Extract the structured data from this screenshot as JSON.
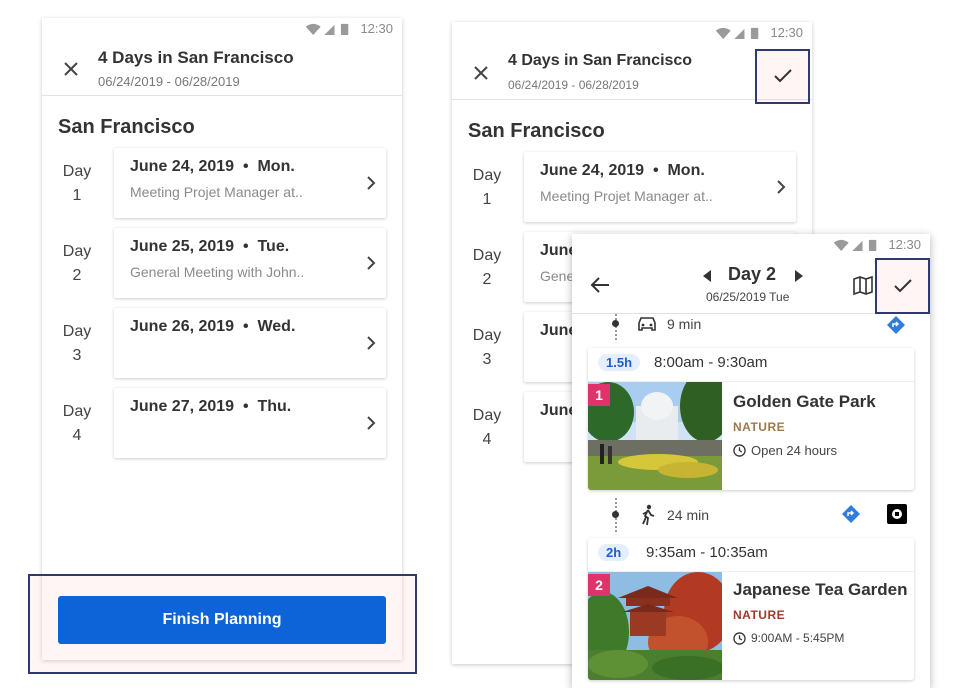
{
  "status": {
    "time": "12:30"
  },
  "trip": {
    "title": "4 Days in San Francisco",
    "dates": "06/24/2019 - 06/28/2019",
    "city": "San Francisco"
  },
  "days": [
    {
      "label_word": "Day",
      "label_num": "1",
      "date": "June 24, 2019",
      "weekday": "Mon.",
      "note": "Meeting Projet Manager at.."
    },
    {
      "label_word": "Day",
      "label_num": "2",
      "date": "June 25, 2019",
      "weekday": "Tue.",
      "note": "General Meeting with John.."
    },
    {
      "label_word": "Day",
      "label_num": "3",
      "date": "June 26, 2019",
      "weekday": "Wed.",
      "note": ""
    },
    {
      "label_word": "Day",
      "label_num": "4",
      "date": "June 27, 2019",
      "weekday": "Thu.",
      "note": ""
    }
  ],
  "mid_days_partial": [
    "June",
    "Gene",
    "June",
    "June"
  ],
  "finish_button": "Finish Planning",
  "day_detail": {
    "title": "Day 2",
    "subtitle": "06/25/2019 Tue",
    "transit_1": {
      "mode_icon": "car-icon",
      "duration": "9 min"
    },
    "stops": [
      {
        "index": "1",
        "duration": "1.5h",
        "time_range": "8:00am - 9:30am",
        "name": "Golden Gate Park",
        "category": "NATURE",
        "category_color": "#a0784a",
        "hours": "Open 24 hours"
      },
      {
        "index": "2",
        "duration": "2h",
        "time_range": "9:35am - 10:35am",
        "name": "Japanese Tea Garden",
        "category": "NATURE",
        "category_color": "#a0392a",
        "hours": "9:00AM - 5:45PM"
      }
    ],
    "transit_2": {
      "mode_icon": "walk-icon",
      "duration": "24 min"
    }
  },
  "colors": {
    "accent": "#0d64d9",
    "highlight_border": "#2e3a6e",
    "badge": "#e0336c",
    "directions": "#2f7de1"
  }
}
